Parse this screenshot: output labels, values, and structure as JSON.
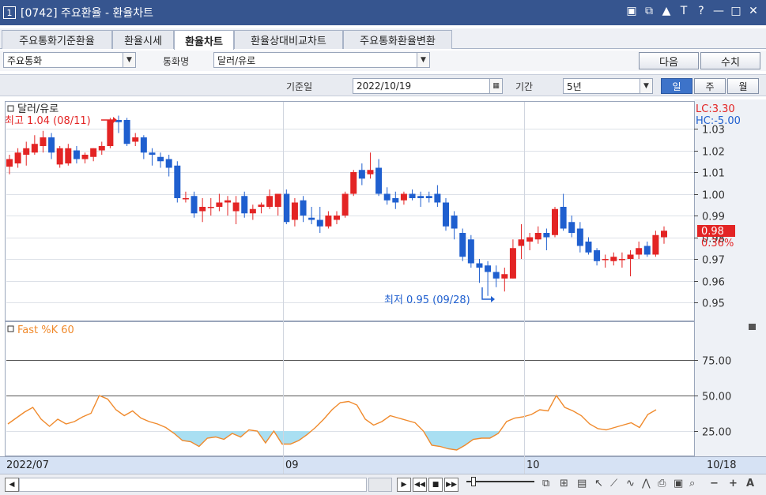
{
  "window": {
    "number": "1",
    "title": "[0742]  주요환율 - 환율차트",
    "tools": [
      "▣",
      "⧉",
      "▲",
      "T",
      "?",
      "—",
      "□",
      "✕"
    ]
  },
  "tabs": [
    {
      "label": "주요통화기준환율"
    },
    {
      "label": "환율시세"
    },
    {
      "label": "환율차트"
    },
    {
      "label": "환율상대비교차트"
    },
    {
      "label": "주요통화환율변환"
    }
  ],
  "filters": {
    "category_value": "주요통화",
    "currency_label": "통화명",
    "currency_value": "달러/유로",
    "next_button": "다음",
    "values_button": "수치"
  },
  "options": {
    "date_label": "기준일",
    "date_value": "2022/10/19",
    "period_label": "기간",
    "period_value": "5년",
    "periods": [
      "일",
      "주",
      "월"
    ]
  },
  "price_panel": {
    "title": "달러/유로",
    "lc_text": "LC:3.30",
    "hc_text": "HC:-5.00",
    "max_text": "최고 1.04 (08/11)",
    "min_text": "최저 0.95 (09/28)",
    "last_value": "0.98",
    "last_change": "0.36%",
    "colors": {
      "up": "#e32424",
      "down": "#1f5fcf"
    }
  },
  "stoch_panel": {
    "title": "Fast %K 60",
    "color": "#f08a2c",
    "fill_color": "#a9dff2"
  },
  "x_axis": {
    "labels": [
      "2022/07",
      "09",
      "10"
    ],
    "end_label": "10/18"
  },
  "chart_data": [
    {
      "type": "candlestick",
      "title": "달러/유로",
      "ylim": [
        0.942,
        1.042
      ],
      "y_ticks": [
        "1.03",
        "1.02",
        "1.01",
        "1.00",
        "0.99",
        "0.98",
        "0.97",
        "0.96",
        "0.95"
      ],
      "candles": [
        {
          "o": 1.0125,
          "h": 1.018,
          "c": 1.016,
          "l": 1.009
        },
        {
          "o": 1.014,
          "h": 1.021,
          "c": 1.019,
          "l": 1.012
        },
        {
          "o": 1.018,
          "h": 1.024,
          "c": 1.021,
          "l": 1.013
        },
        {
          "o": 1.019,
          "h": 1.027,
          "c": 1.023,
          "l": 1.018
        },
        {
          "o": 1.022,
          "h": 1.029,
          "c": 1.026,
          "l": 1.019
        },
        {
          "o": 1.026,
          "h": 1.028,
          "c": 1.019,
          "l": 1.016
        },
        {
          "o": 1.0135,
          "h": 1.022,
          "c": 1.021,
          "l": 1.012
        },
        {
          "o": 1.014,
          "h": 1.023,
          "c": 1.021,
          "l": 1.013
        },
        {
          "o": 1.02,
          "h": 1.022,
          "c": 1.016,
          "l": 1.014
        },
        {
          "o": 1.016,
          "h": 1.019,
          "c": 1.018,
          "l": 1.014
        },
        {
          "o": 1.017,
          "h": 1.021,
          "c": 1.021,
          "l": 1.015
        },
        {
          "o": 1.02,
          "h": 1.024,
          "c": 1.022,
          "l": 1.018
        },
        {
          "o": 1.022,
          "h": 1.035,
          "c": 1.034,
          "l": 1.021
        },
        {
          "o": 1.034,
          "h": 1.036,
          "c": 1.033,
          "l": 1.028
        },
        {
          "o": 1.034,
          "h": 1.035,
          "c": 1.023,
          "l": 1.022
        },
        {
          "o": 1.024,
          "h": 1.028,
          "c": 1.026,
          "l": 1.022
        },
        {
          "o": 1.026,
          "h": 1.027,
          "c": 1.019,
          "l": 1.016
        },
        {
          "o": 1.019,
          "h": 1.021,
          "c": 1.018,
          "l": 1.013
        },
        {
          "o": 1.017,
          "h": 1.019,
          "c": 1.015,
          "l": 1.012
        },
        {
          "o": 1.016,
          "h": 1.018,
          "c": 1.012,
          "l": 1.008
        },
        {
          "o": 1.013,
          "h": 1.015,
          "c": 0.998,
          "l": 0.996
        },
        {
          "o": 0.998,
          "h": 1.001,
          "c": 0.998,
          "l": 0.996
        },
        {
          "o": 0.999,
          "h": 1.001,
          "c": 0.991,
          "l": 0.989
        },
        {
          "o": 0.992,
          "h": 0.998,
          "c": 0.994,
          "l": 0.987
        },
        {
          "o": 0.994,
          "h": 0.998,
          "c": 0.994,
          "l": 0.99
        },
        {
          "o": 0.994,
          "h": 1.0,
          "c": 0.996,
          "l": 0.992
        },
        {
          "o": 0.996,
          "h": 0.999,
          "c": 0.997,
          "l": 0.99
        },
        {
          "o": 0.992,
          "h": 0.999,
          "c": 0.996,
          "l": 0.986
        },
        {
          "o": 0.999,
          "h": 1.001,
          "c": 0.991,
          "l": 0.989
        },
        {
          "o": 0.991,
          "h": 0.995,
          "c": 0.993,
          "l": 0.988
        },
        {
          "o": 0.994,
          "h": 0.996,
          "c": 0.995,
          "l": 0.991
        },
        {
          "o": 0.994,
          "h": 1.002,
          "c": 0.999,
          "l": 0.993
        },
        {
          "o": 0.994,
          "h": 1.0,
          "c": 1.0,
          "l": 0.99
        },
        {
          "o": 1.0,
          "h": 1.002,
          "c": 0.987,
          "l": 0.986
        },
        {
          "o": 0.988,
          "h": 0.998,
          "c": 0.996,
          "l": 0.985
        },
        {
          "o": 0.997,
          "h": 0.999,
          "c": 0.99,
          "l": 0.987
        },
        {
          "o": 0.989,
          "h": 0.994,
          "c": 0.988,
          "l": 0.986
        },
        {
          "o": 0.988,
          "h": 0.994,
          "c": 0.985,
          "l": 0.982
        },
        {
          "o": 0.985,
          "h": 0.992,
          "c": 0.99,
          "l": 0.984
        },
        {
          "o": 0.988,
          "h": 0.992,
          "c": 0.99,
          "l": 0.986
        },
        {
          "o": 0.99,
          "h": 1.001,
          "c": 1.0,
          "l": 0.989
        },
        {
          "o": 1.0,
          "h": 1.011,
          "c": 1.01,
          "l": 0.999
        },
        {
          "o": 1.011,
          "h": 1.014,
          "c": 1.007,
          "l": 1.004
        },
        {
          "o": 1.009,
          "h": 1.019,
          "c": 1.011,
          "l": 1.007
        },
        {
          "o": 1.012,
          "h": 1.016,
          "c": 1.0,
          "l": 0.999
        },
        {
          "o": 1.0,
          "h": 1.003,
          "c": 0.997,
          "l": 0.995
        },
        {
          "o": 0.998,
          "h": 1.001,
          "c": 0.996,
          "l": 0.993
        },
        {
          "o": 0.997,
          "h": 1.001,
          "c": 1.0,
          "l": 0.995
        },
        {
          "o": 1.0,
          "h": 1.002,
          "c": 0.998,
          "l": 0.997
        },
        {
          "o": 0.999,
          "h": 1.001,
          "c": 0.998,
          "l": 0.994
        },
        {
          "o": 0.999,
          "h": 1.001,
          "c": 0.998,
          "l": 0.996
        },
        {
          "o": 1.0,
          "h": 1.004,
          "c": 0.996,
          "l": 0.994
        },
        {
          "o": 0.996,
          "h": 0.998,
          "c": 0.985,
          "l": 0.983
        },
        {
          "o": 0.99,
          "h": 0.992,
          "c": 0.984,
          "l": 0.979
        },
        {
          "o": 0.982,
          "h": 0.984,
          "c": 0.971,
          "l": 0.969
        },
        {
          "o": 0.979,
          "h": 0.981,
          "c": 0.968,
          "l": 0.966
        },
        {
          "o": 0.968,
          "h": 0.97,
          "c": 0.966,
          "l": 0.959
        },
        {
          "o": 0.967,
          "h": 0.969,
          "c": 0.964,
          "l": 0.953
        },
        {
          "o": 0.964,
          "h": 0.967,
          "c": 0.961,
          "l": 0.957
        },
        {
          "o": 0.961,
          "h": 0.966,
          "c": 0.963,
          "l": 0.955
        },
        {
          "o": 0.961,
          "h": 0.979,
          "c": 0.975,
          "l": 0.961
        },
        {
          "o": 0.976,
          "h": 0.986,
          "c": 0.979,
          "l": 0.97
        },
        {
          "o": 0.978,
          "h": 0.982,
          "c": 0.98,
          "l": 0.974
        },
        {
          "o": 0.979,
          "h": 0.985,
          "c": 0.982,
          "l": 0.977
        },
        {
          "o": 0.982,
          "h": 0.984,
          "c": 0.98,
          "l": 0.974
        },
        {
          "o": 0.981,
          "h": 0.994,
          "c": 0.993,
          "l": 0.98
        },
        {
          "o": 0.994,
          "h": 1.0,
          "c": 0.984,
          "l": 0.983
        },
        {
          "o": 0.987,
          "h": 0.99,
          "c": 0.982,
          "l": 0.98
        },
        {
          "o": 0.984,
          "h": 0.987,
          "c": 0.976,
          "l": 0.973
        },
        {
          "o": 0.978,
          "h": 0.98,
          "c": 0.973,
          "l": 0.972
        },
        {
          "o": 0.974,
          "h": 0.975,
          "c": 0.969,
          "l": 0.967
        },
        {
          "o": 0.97,
          "h": 0.972,
          "c": 0.97,
          "l": 0.966
        },
        {
          "o": 0.969,
          "h": 0.973,
          "c": 0.971,
          "l": 0.967
        },
        {
          "o": 0.97,
          "h": 0.973,
          "c": 0.97,
          "l": 0.966
        },
        {
          "o": 0.97,
          "h": 0.974,
          "c": 0.972,
          "l": 0.962
        },
        {
          "o": 0.972,
          "h": 0.978,
          "c": 0.975,
          "l": 0.97
        },
        {
          "o": 0.976,
          "h": 0.978,
          "c": 0.972,
          "l": 0.971
        },
        {
          "o": 0.972,
          "h": 0.983,
          "c": 0.981,
          "l": 0.971
        },
        {
          "o": 0.98,
          "h": 0.985,
          "c": 0.983,
          "l": 0.977
        }
      ]
    },
    {
      "type": "line",
      "title": "Fast %K 60",
      "ylim": [
        0,
        100
      ],
      "y_ticks": [
        "75.00",
        "50.00",
        "25.00"
      ],
      "y_levels": [
        80,
        50,
        20
      ],
      "values": [
        26,
        31,
        36,
        40,
        30,
        24,
        30,
        26,
        28,
        32,
        35,
        50,
        47,
        38,
        33,
        37,
        31,
        28,
        26,
        23,
        18,
        12,
        11,
        7,
        14,
        15,
        13,
        18,
        15,
        21,
        20,
        10,
        20,
        9,
        9,
        12,
        17,
        23,
        30,
        38,
        44,
        45,
        42,
        30,
        25,
        28,
        33,
        31,
        29,
        27,
        20,
        8,
        7,
        5,
        4,
        8,
        13,
        14,
        14,
        18,
        28,
        31,
        32,
        34,
        38,
        37,
        50,
        40,
        37,
        33,
        26,
        22,
        21,
        23,
        25,
        27,
        23,
        34,
        38
      ]
    }
  ]
}
